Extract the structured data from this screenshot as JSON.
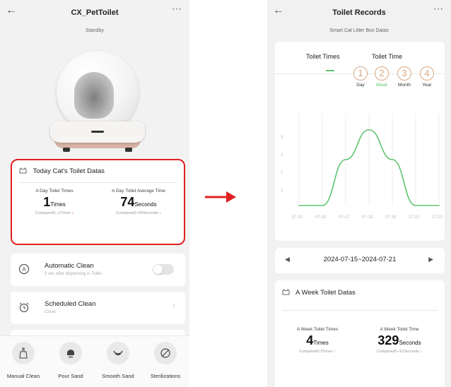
{
  "left_screen": {
    "title": "CX_PetToilet",
    "status": "Standby",
    "today_card": {
      "heading": "Today Cat's Toilet Datas",
      "times_label": "A Day Toilet Times",
      "times_value": "1",
      "times_unit": "Times",
      "times_compare": "Compared0--1Times",
      "avg_label": "A Day Toilet Average Time",
      "avg_value": "74",
      "avg_unit": "Seconds",
      "avg_compare": "Compared0--56Seconds"
    },
    "auto_clean": {
      "title": "Automatic Clean",
      "subtitle": "0 sec after dispensing in Toilet",
      "enabled": false
    },
    "scheduled_clean": {
      "title": "Scheduled Clean",
      "subtitle": "Close"
    },
    "bottom_actions": [
      {
        "label": "Manual Clean",
        "icon": "broom-icon"
      },
      {
        "label": "Pour Sand",
        "icon": "pour-sand-icon"
      },
      {
        "label": "Smooth Sand",
        "icon": "smooth-sand-icon"
      },
      {
        "label": "Sterilizations",
        "icon": "sterilize-icon"
      }
    ]
  },
  "right_screen": {
    "title": "Toilet Records",
    "subtitle": "Smart Cat Litter Box Datas",
    "tabs": [
      "Toilet Times",
      "Toilet Time"
    ],
    "ranges": [
      {
        "num": "1",
        "label": "Day"
      },
      {
        "num": "2",
        "label": "Week"
      },
      {
        "num": "3",
        "label": "Month"
      },
      {
        "num": "4",
        "label": "Year"
      }
    ],
    "active_range": "Week",
    "date_range": "2024-07-15~2024-07-21",
    "week_card": {
      "heading": "A Week Toilet Datas",
      "times_label": "A Week Toilet Times",
      "times_value": "4",
      "times_unit": "Times",
      "times_compare": "Compared0:3Times",
      "time_label": "A Week Toilet Time",
      "time_value": "329",
      "time_unit": "Seconds",
      "time_compare": "Compared0--51Seconds"
    }
  },
  "colors": {
    "highlight_border": "#e02020",
    "accent_green": "#5ec46f",
    "range_circle": "#d9a683",
    "arrow": "#e02020"
  },
  "chart_data": {
    "type": "line",
    "x": [
      "07-15",
      "07-16",
      "07-17",
      "07-18",
      "07-19",
      "07-20",
      "07-21"
    ],
    "series": [
      {
        "values": [
          0,
          0,
          2,
          3.3,
          2,
          0,
          0
        ]
      }
    ],
    "y_ticks": [
      "1",
      "1",
      "2",
      "3"
    ],
    "ylim": [
      0,
      4
    ],
    "grid": "vertical",
    "line_color": "#5ec46f"
  }
}
